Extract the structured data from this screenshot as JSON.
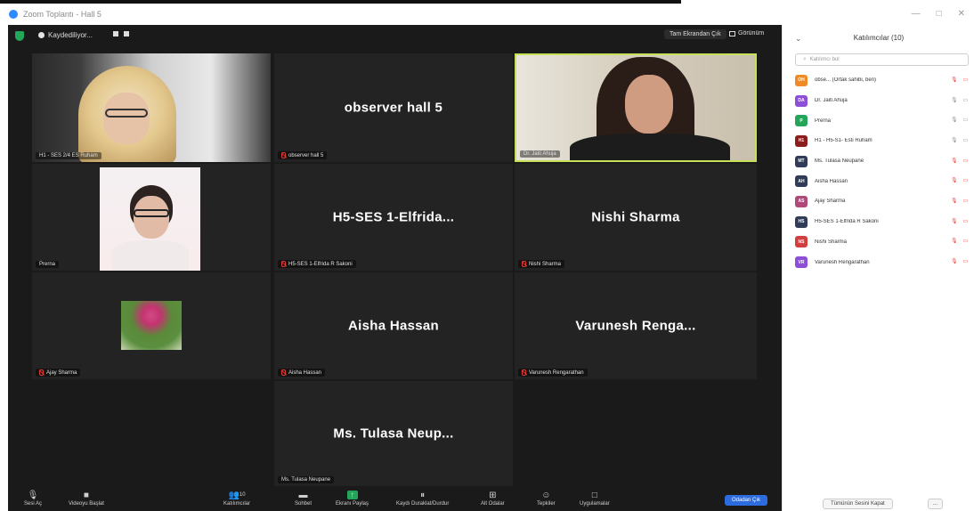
{
  "window": {
    "title": "Zoom Toplantı - Hall 5",
    "controls": [
      "—",
      "□",
      "✕"
    ]
  },
  "topbar": {
    "recording_label": "Kaydediliyor...",
    "exit_fullscreen": "Tam Ekrandan Çık",
    "view": "Görünüm"
  },
  "tiles": [
    {
      "id": "t1",
      "display": "",
      "nameplate": "H1 - SES 2/4 ES Ruham",
      "muted": false,
      "video": true
    },
    {
      "id": "t2",
      "display": "observer hall 5",
      "nameplate": "observer hall 5",
      "muted": true,
      "video": false
    },
    {
      "id": "t3",
      "display": "",
      "nameplate": "Dr. Jaiti Ahuja",
      "muted": false,
      "video": true
    },
    {
      "id": "t4",
      "display": "",
      "nameplate": "Prerna",
      "muted": false,
      "video": true
    },
    {
      "id": "t5",
      "display": "H5-SES 1-Elfrida...",
      "nameplate": "H5-SES 1-Elfrida R Sakoni",
      "muted": true,
      "video": false
    },
    {
      "id": "t6",
      "display": "Nishi Sharma",
      "nameplate": "Nishi Sharma",
      "muted": true,
      "video": false
    },
    {
      "id": "t7",
      "display": "",
      "nameplate": "Ajay Sharma",
      "muted": true,
      "video": false
    },
    {
      "id": "t8",
      "display": "Aisha Hassan",
      "nameplate": "Aisha Hassan",
      "muted": true,
      "video": false
    },
    {
      "id": "t9",
      "display": "Varunesh Renga...",
      "nameplate": "Varunesh Rengarathan",
      "muted": true,
      "video": false
    },
    {
      "id": "t10",
      "display": "Ms. Tulasa Neup...",
      "nameplate": "Ms. Tulasa Neupane",
      "muted": false,
      "video": false
    }
  ],
  "toolbar": {
    "mute": "Sesi Aç",
    "video": "Videoyu Başlat",
    "participants": "Katılımcılar",
    "participants_count": "10",
    "chat": "Sohbet",
    "share": "Ekranı Paylaş",
    "record": "Kaydı Duraklat/Durdur",
    "breakout": "Alt Odalar",
    "reactions": "Tepkiler",
    "apps": "Uygulamalar",
    "leave": "Odadan Çık"
  },
  "panel": {
    "title": "Katılımcılar (10)",
    "search_placeholder": "Katılımcı bul",
    "participants": [
      {
        "initials": "OH",
        "name": "obse... (Ortak sahibi, ben)",
        "color": "#f08a24",
        "mic": "off",
        "cam": "off"
      },
      {
        "initials": "DA",
        "name": "Dr. Jaiti Ahuja",
        "color": "#8e4fd8",
        "mic": "on",
        "cam": "on"
      },
      {
        "initials": "P",
        "name": "Prerna",
        "color": "#23a55a",
        "mic": "on",
        "cam": "on"
      },
      {
        "initials": "H1",
        "name": "H1 - H5-S1- Esti Ruham",
        "color": "#8b1d1d",
        "mic": "on",
        "cam": "on"
      },
      {
        "initials": "MT",
        "name": "Ms. Tulasa Neupane",
        "color": "#2f3b57",
        "mic": "off",
        "cam": "off"
      },
      {
        "initials": "AH",
        "name": "Aisha Hassan",
        "color": "#2f3b57",
        "mic": "off",
        "cam": "off"
      },
      {
        "initials": "AS",
        "name": "Ajay Sharma",
        "color": "#b0497a",
        "mic": "off",
        "cam": "off"
      },
      {
        "initials": "HS",
        "name": "H5-SES 1-Elfrida R Sakoni",
        "color": "#2f3b57",
        "mic": "off",
        "cam": "off"
      },
      {
        "initials": "NS",
        "name": "Nishi Sharma",
        "color": "#d23f3f",
        "mic": "off",
        "cam": "off"
      },
      {
        "initials": "VR",
        "name": "Varunesh Rengarathan",
        "color": "#8e4fd8",
        "mic": "off",
        "cam": "off"
      }
    ],
    "mute_all": "Tümünün Sesini Kapat",
    "more": "..."
  }
}
